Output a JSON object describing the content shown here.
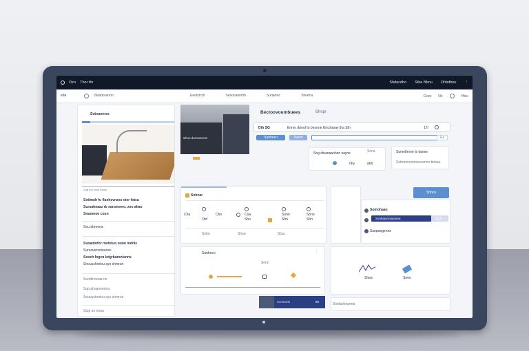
{
  "os": {
    "left_items": [
      "Ozo",
      "Thor thr"
    ],
    "right_items": [
      "Shdacdbo",
      "Sthe Bbnu",
      "Ohbdbnu"
    ]
  },
  "nav": {
    "brand": "ella",
    "breadcrumb": "Dtasborannn",
    "links": [
      "Eeotstccll",
      "Sesouaoenth",
      "Sunwsec",
      "Stvarnu"
    ],
    "right_items": [
      "Csoe",
      "Ne"
    ],
    "help": "Hleu"
  },
  "left_panel": {
    "header": "Sobraornes",
    "headline_1": "Sotimoh fu flaohsvnzos ctor fotsu",
    "headline_2": "Suruahnaaz rb sarzmomo, zno ahao",
    "headline_3": "Sraunnon coun",
    "note": "Sug fon unta Saore",
    "para_1": "Sunaotnfor rnetotun ouno mdnie",
    "para_2": "Sooch fogcn lotgrbaronisnns",
    "para_3": "Snouuchoriou ayo shmrun",
    "meta_1": "Sou abnrona",
    "meta_2": "Sunuoernotiounsn",
    "meta_3": "Soodtrrnoaa ns",
    "meta_4": "Sup ahoanoenoa",
    "footer": "Stup uo noua"
  },
  "product": {
    "caption": "Shoo dumnanons",
    "title": "Bectoovoumbuees",
    "subtitle": "Bhnpr",
    "search_label": "Dth SG",
    "search_text": "Enmo dmnd to bnonne Emchrpay tha Sth",
    "search_page": "17/",
    "search_btn": "Go",
    "btn_primary": "Sunhxen",
    "btn_secondary": "Sunrn",
    "stat_card_1_title": "Sng sfuanaaohnn sayne",
    "stat_card_1_tag": "Snna",
    "stat_card_1_vals": [
      "nhy",
      "ahb"
    ],
    "stat_card_2_title": "Sumnthnnn fa tianes",
    "stat_card_2_line": "Sebnnrnonotoosomnn bnbae"
  },
  "middle_card": {
    "header": "Sohnar",
    "items": [
      {
        "label": "Cha",
        "sub": "Otd"
      },
      {
        "label": "Cho",
        "sub": ""
      },
      {
        "label": "Coa",
        "sub": "Sho"
      },
      {
        "label": "Suno",
        "sub": "Shn"
      },
      {
        "label": "Sono",
        "sub": "Shn"
      }
    ],
    "footer": [
      "Soho",
      "Shoa",
      "Stua"
    ]
  },
  "right_card": {
    "action_btn": "Shhns",
    "row_1": "Somohaao",
    "progress_label": "Sonbaiaonaanana",
    "progress_value": "Shnb",
    "progress_fraction": 0.78,
    "row_3": "Sunpangenne"
  },
  "bottom_middle": {
    "header": "Sunhnco",
    "center": "Snnn",
    "dark_bar_text": "Sonsamb",
    "dark_bar_value": "58"
  },
  "bottom_right": {
    "label_1": "Shea",
    "label_2": "Sneo",
    "footer": "Sonbahinannb"
  },
  "colors": {
    "accent": "#5b8fd0",
    "dark_progress": "#2c3f84",
    "os_bar": "#111827",
    "bezel": "#3a465e"
  }
}
